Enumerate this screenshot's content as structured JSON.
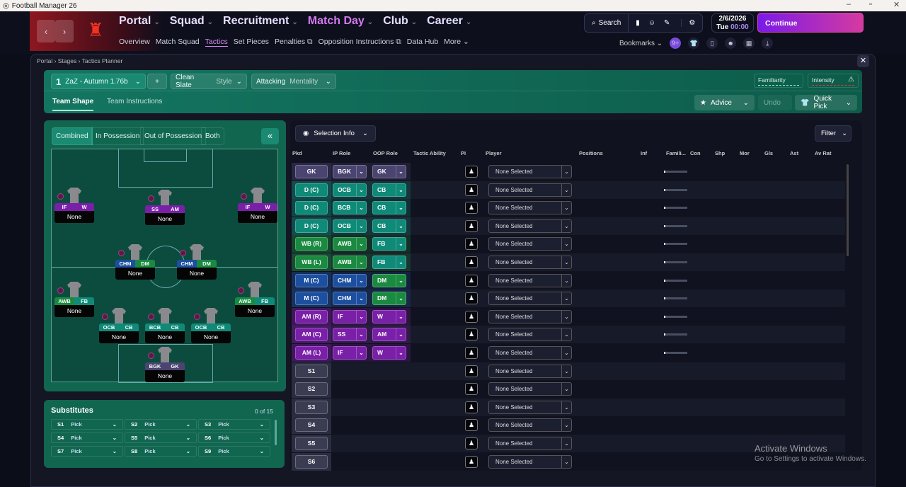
{
  "window": {
    "title": "Football Manager 26"
  },
  "nav": {
    "main": [
      {
        "label": "Portal",
        "active": false
      },
      {
        "label": "Squad",
        "active": false
      },
      {
        "label": "Recruitment",
        "active": false
      },
      {
        "label": "Match Day",
        "active": true
      },
      {
        "label": "Club",
        "active": false
      },
      {
        "label": "Career",
        "active": false
      }
    ],
    "sub": [
      "Overview",
      "Match Squad",
      "Tactics",
      "Set Pieces",
      "Penalties",
      "Opposition Instructions",
      "Data Hub",
      "More"
    ],
    "sub_active": "Tactics",
    "search": "Search",
    "date": "2/6/2026",
    "day": "Tue",
    "time": "00:00",
    "continue": "Continue",
    "bookmarks": "Bookmarks",
    "notif_badge": "9+"
  },
  "breadcrumb": [
    "Portal",
    "Stages",
    "Tactics Planner"
  ],
  "tactic": {
    "slot": "1",
    "name": "ZaZ - Autumn 1.76b",
    "add": "+",
    "style_value": "Clean Slate",
    "style_label": "Style",
    "mentality_value": "Attacking",
    "mentality_label": "Mentality",
    "familiarity": "Familiarity",
    "intensity": "Intensity",
    "tabs": [
      "Team Shape",
      "Team Instructions"
    ],
    "active_tab": "Team Shape",
    "advice": "Advice",
    "undo": "Undo",
    "quick_pick": "Quick Pick"
  },
  "pitch": {
    "tabs": [
      "Combined",
      "In Possession",
      "Out of Possession",
      "Both"
    ],
    "active_tab": "Combined",
    "players": [
      {
        "ip": "IF",
        "oop": "W",
        "name": "None",
        "c1": "#7a1fa8",
        "c2": "#7a1fa8"
      },
      {
        "ip": "SS",
        "oop": "AM",
        "name": "None",
        "c1": "#7a1fa8",
        "c2": "#7a1fa8"
      },
      {
        "ip": "IF",
        "oop": "W",
        "name": "None",
        "c1": "#7a1fa8",
        "c2": "#7a1fa8"
      },
      {
        "ip": "CHM",
        "oop": "DM",
        "name": "None",
        "c1": "#1d4fa0",
        "c2": "#1a8a40"
      },
      {
        "ip": "CHM",
        "oop": "DM",
        "name": "None",
        "c1": "#1d4fa0",
        "c2": "#1a8a40"
      },
      {
        "ip": "AWB",
        "oop": "FB",
        "name": "None",
        "c1": "#1a8a40",
        "c2": "#0f8a78"
      },
      {
        "ip": "AWB",
        "oop": "FB",
        "name": "None",
        "c1": "#1a8a40",
        "c2": "#0f8a78"
      },
      {
        "ip": "OCB",
        "oop": "CB",
        "name": "None",
        "c1": "#0f8a78",
        "c2": "#0f8a78"
      },
      {
        "ip": "BCB",
        "oop": "CB",
        "name": "None",
        "c1": "#0f8a78",
        "c2": "#0f8a78"
      },
      {
        "ip": "OCB",
        "oop": "CB",
        "name": "None",
        "c1": "#0f8a78",
        "c2": "#0f8a78"
      },
      {
        "ip": "BGK",
        "oop": "GK",
        "name": "None",
        "c1": "#4a4470",
        "c2": "#4a4470"
      }
    ]
  },
  "subs": {
    "title": "Substitutes",
    "count": "0 of 15",
    "slots": [
      {
        "id": "S1",
        "value": "Pick"
      },
      {
        "id": "S2",
        "value": "Pick"
      },
      {
        "id": "S3",
        "value": "Pick"
      },
      {
        "id": "S4",
        "value": "Pick"
      },
      {
        "id": "S5",
        "value": "Pick"
      },
      {
        "id": "S6",
        "value": "Pick"
      },
      {
        "id": "S7",
        "value": "Pick"
      },
      {
        "id": "S8",
        "value": "Pick"
      },
      {
        "id": "S9",
        "value": "Pick"
      }
    ]
  },
  "table": {
    "selection_info": "Selection Info",
    "filter": "Filter",
    "headers": [
      "Pkd",
      "IP Role",
      "OOP Role",
      "Tactic Ability",
      "PI",
      "Player",
      "Positions",
      "Inf",
      "Famili...",
      "Con",
      "Shp",
      "Mor",
      "Gls",
      "Ast",
      "Av Rat"
    ],
    "rows": [
      {
        "pkd": "GK",
        "ip": "BGK",
        "oop": "GK",
        "player": "None Selected",
        "color": "#4a4470"
      },
      {
        "pkd": "D (C)",
        "ip": "OCB",
        "oop": "CB",
        "player": "None Selected",
        "color": "#0f8a78"
      },
      {
        "pkd": "D (C)",
        "ip": "BCB",
        "oop": "CB",
        "player": "None Selected",
        "color": "#0f8a78"
      },
      {
        "pkd": "D (C)",
        "ip": "OCB",
        "oop": "CB",
        "player": "None Selected",
        "color": "#0f8a78"
      },
      {
        "pkd": "WB (R)",
        "ip": "AWB",
        "oop": "FB",
        "player": "None Selected",
        "color": "#1a8a40",
        "color2": "#0f8a78"
      },
      {
        "pkd": "WB (L)",
        "ip": "AWB",
        "oop": "FB",
        "player": "None Selected",
        "color": "#1a8a40",
        "color2": "#0f8a78"
      },
      {
        "pkd": "M (C)",
        "ip": "CHM",
        "oop": "DM",
        "player": "None Selected",
        "color": "#1d4fa0",
        "color2": "#1a8a40"
      },
      {
        "pkd": "M (C)",
        "ip": "CHM",
        "oop": "DM",
        "player": "None Selected",
        "color": "#1d4fa0",
        "color2": "#1a8a40"
      },
      {
        "pkd": "AM (R)",
        "ip": "IF",
        "oop": "W",
        "player": "None Selected",
        "color": "#7a1fa8"
      },
      {
        "pkd": "AM (C)",
        "ip": "SS",
        "oop": "AM",
        "player": "None Selected",
        "color": "#7a1fa8"
      },
      {
        "pkd": "AM (L)",
        "ip": "IF",
        "oop": "W",
        "player": "None Selected",
        "color": "#7a1fa8"
      },
      {
        "pkd": "S1",
        "player": "None Selected"
      },
      {
        "pkd": "S2",
        "player": "None Selected"
      },
      {
        "pkd": "S3",
        "player": "None Selected"
      },
      {
        "pkd": "S4",
        "player": "None Selected"
      },
      {
        "pkd": "S5",
        "player": "None Selected"
      },
      {
        "pkd": "S6",
        "player": "None Selected"
      }
    ]
  },
  "watermark": {
    "title": "Activate Windows",
    "subtitle": "Go to Settings to activate Windows."
  }
}
